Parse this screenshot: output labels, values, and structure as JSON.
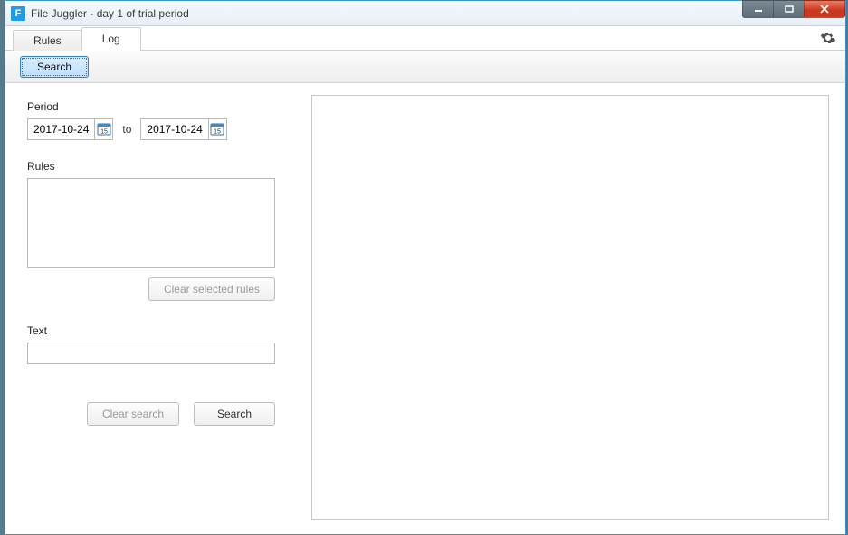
{
  "window": {
    "title": "File Juggler - day 1 of trial period",
    "app_icon_letter": "F"
  },
  "tabs": {
    "rules": "Rules",
    "log": "Log"
  },
  "toolbar": {
    "search_label": "Search"
  },
  "panel": {
    "period_label": "Period",
    "date_from": "2017-10-24",
    "to_label": "to",
    "date_to": "2017-10-24",
    "cal_day": "15",
    "rules_label": "Rules",
    "clear_rules_label": "Clear selected rules",
    "text_label": "Text",
    "text_value": "",
    "clear_search_label": "Clear search",
    "search_label": "Search"
  }
}
